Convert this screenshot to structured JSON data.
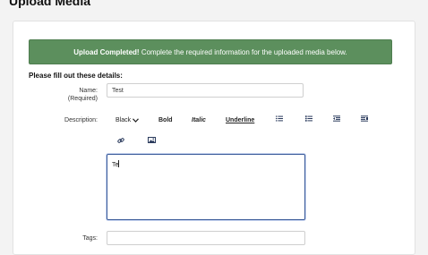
{
  "page": {
    "title": "Upload Media"
  },
  "banner": {
    "strong": "Upload Completed!",
    "message": " Complete the required information for the uploaded media below.",
    "color": "#5c8f5d"
  },
  "form": {
    "section_title": "Please fill out these details:",
    "name": {
      "label": "Name:",
      "sublabel": "(Required)",
      "value": "Test"
    },
    "description": {
      "label": "Description:",
      "text": "Te"
    },
    "tags": {
      "label": "Tags:",
      "value": ""
    }
  },
  "toolbar": {
    "color_select": "Black",
    "bold": "Bold",
    "italic": "Italic",
    "underline": "Underline",
    "icons": [
      "unordered-list-icon",
      "ordered-list-icon",
      "outdent-icon",
      "indent-icon",
      "link-icon",
      "image-icon"
    ]
  }
}
